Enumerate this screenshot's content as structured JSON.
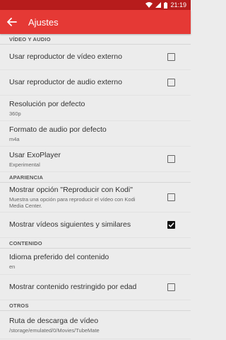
{
  "status_bar": {
    "time": "21:19"
  },
  "app_bar": {
    "title": "Ajustes",
    "back_icon": "arrow-back-icon"
  },
  "colors": {
    "status_bar": "#b71c1c",
    "app_bar": "#e53935",
    "background": "#ececec",
    "checkbox_checked": "#111111"
  },
  "sections": [
    {
      "header": "VÍDEO Y AUDIO",
      "items": [
        {
          "label": "Usar reproductor de vídeo externo",
          "summary": "",
          "checkbox": true,
          "checked": false
        },
        {
          "label": "Usar reproductor de audio externo",
          "summary": "",
          "checkbox": true,
          "checked": false
        },
        {
          "label": "Resolución por defecto",
          "summary": "360p",
          "checkbox": false
        },
        {
          "label": "Formato de audio por defecto",
          "summary": "m4a",
          "checkbox": false
        },
        {
          "label": "Usar ExoPlayer",
          "summary": "Experimental",
          "checkbox": true,
          "checked": false
        }
      ]
    },
    {
      "header": "APARIENCIA",
      "items": [
        {
          "label": "Mostrar opción \"Reproducir con Kodi\"",
          "summary": "Muestra una opción para reproducir el vídeo con Kodi Media Center.",
          "checkbox": true,
          "checked": false
        },
        {
          "label": "Mostrar vídeos siguientes y similares",
          "summary": "",
          "checkbox": true,
          "checked": true
        }
      ]
    },
    {
      "header": "CONTENIDO",
      "items": [
        {
          "label": "Idioma preferido del contenido",
          "summary": "en",
          "checkbox": false
        },
        {
          "label": "Mostrar contenido restringido por edad",
          "summary": "",
          "checkbox": true,
          "checked": false
        }
      ]
    },
    {
      "header": "OTROS",
      "items": [
        {
          "label": "Ruta de descarga de vídeo",
          "summary": "/storage/emulated/0/Movies/TubeMate",
          "checkbox": false
        }
      ]
    }
  ]
}
